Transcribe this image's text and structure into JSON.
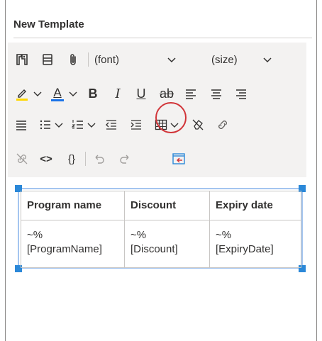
{
  "panel": {
    "title": "New Template"
  },
  "toolbar": {
    "font_label": "(font)",
    "size_label": "(size)",
    "bold": "B",
    "italic": "I",
    "underline": "U",
    "strikethrough": "ab",
    "code": "<>",
    "braces": "{}",
    "font_color_letter": "A",
    "colors": {
      "highlight": "#ffd700",
      "font_color": "#1a73e8",
      "highlight_ring": "#d13438",
      "accent_icon": "#2b88d8"
    },
    "icons": [
      "insert-template-icon",
      "format-list-icon",
      "attachment-icon",
      "highlight-icon",
      "font-color-icon",
      "bold-icon",
      "italic-icon",
      "underline-icon",
      "strikethrough-icon",
      "align-left-icon",
      "align-center-icon",
      "align-right-icon",
      "justify-icon",
      "bullet-list-icon",
      "numbered-list-icon",
      "decrease-indent-icon",
      "increase-indent-icon",
      "table-icon",
      "clear-format-icon",
      "link-icon",
      "unlink-icon",
      "code-icon",
      "braces-icon",
      "undo-icon",
      "redo-icon",
      "insert-dynamic-content-icon"
    ]
  },
  "table": {
    "headers": [
      "Program name",
      "Discount",
      "Expiry date"
    ],
    "rows": [
      [
        "~%\n[ProgramName]",
        "~%\n[Discount]",
        "~%\n[ExpiryDate]"
      ]
    ],
    "cells": {
      "r1c1a": "~%",
      "r1c1b": "[ProgramName]",
      "r1c2a": "~%",
      "r1c2b": "[Discount]",
      "r1c3a": "~%",
      "r1c3b": "[ExpiryDate]"
    }
  }
}
